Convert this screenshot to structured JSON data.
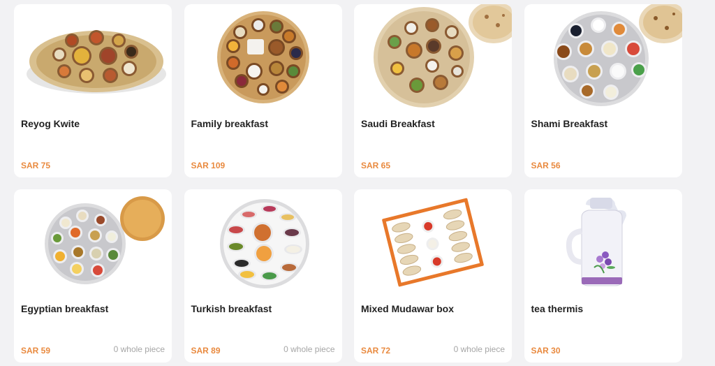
{
  "accent_color": "#e98a3f",
  "products": [
    {
      "name": "Reyog Kwite",
      "price": "SAR 75",
      "unit": "",
      "image_icon": "woven-platter-bowls-icon"
    },
    {
      "name": "Family breakfast",
      "price": "SAR 109",
      "unit": "",
      "image_icon": "round-tray-bowls-icon"
    },
    {
      "name": "Saudi Breakfast",
      "price": "SAR 65",
      "unit": "",
      "image_icon": "woven-platter-bread-icon"
    },
    {
      "name": "Shami Breakfast",
      "price": "SAR 56",
      "unit": "",
      "image_icon": "steel-tray-bread-icon"
    },
    {
      "name": "Egyptian breakfast",
      "price": "SAR 59",
      "unit": "0 whole piece",
      "image_icon": "steel-tray-pie-icon"
    },
    {
      "name": "Turkish breakfast",
      "price": "SAR 89",
      "unit": "0 whole piece",
      "image_icon": "white-tray-icon"
    },
    {
      "name": "Mixed Mudawar box",
      "price": "SAR 72",
      "unit": "0 whole piece",
      "image_icon": "pastry-box-icon"
    },
    {
      "name": "tea thermis",
      "price": "SAR 30",
      "unit": "",
      "image_icon": "thermos-icon"
    }
  ]
}
